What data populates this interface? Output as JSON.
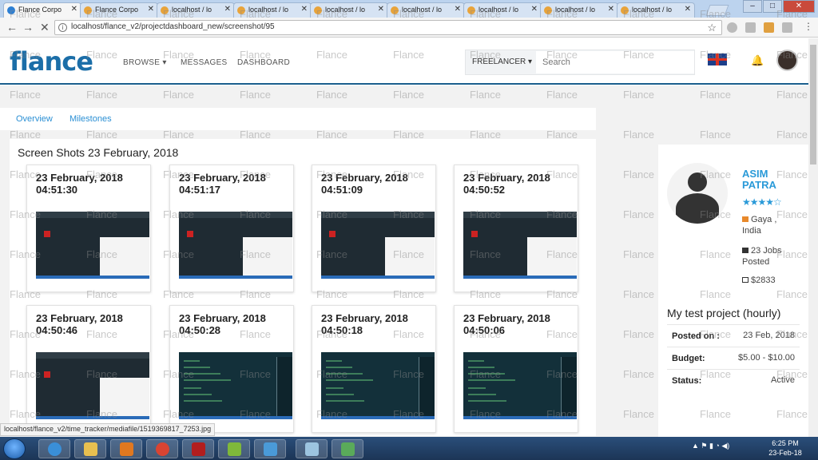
{
  "browser": {
    "tabs": [
      {
        "label": "Flance Corpo",
        "active": true
      },
      {
        "label": "Flance Corpo",
        "active": false
      },
      {
        "label": "localhost / lo",
        "active": false
      },
      {
        "label": "localhost / lo",
        "active": false
      },
      {
        "label": "localhost / lo",
        "active": false
      },
      {
        "label": "localhost / lo",
        "active": false
      },
      {
        "label": "localhost / lo",
        "active": false
      },
      {
        "label": "localhost / lo",
        "active": false
      },
      {
        "label": "localhost / lo",
        "active": false
      }
    ],
    "url": "localhost/flance_v2/projectdashboard_new/screenshot/95",
    "status_url": "localhost/flance_v2/time_tracker/mediafile/1519369817_7253.jpg"
  },
  "header": {
    "logo_text": "flance",
    "nav": {
      "browse": "BROWSE ▾",
      "messages": "MESSAGES",
      "dashboard": "DASHBOARD"
    },
    "search_mode": "FREELANCER ▾",
    "search_placeholder": "Search"
  },
  "subtabs": {
    "overview": "Overview",
    "milestones": "Milestones"
  },
  "screenshots": {
    "title": "Screen Shots 23 February, 2018",
    "items": [
      {
        "date": "23 February, 2018",
        "time": "04:51:30",
        "style": "dark"
      },
      {
        "date": "23 February, 2018",
        "time": "04:51:17",
        "style": "dark"
      },
      {
        "date": "23 February, 2018",
        "time": "04:51:09",
        "style": "dark"
      },
      {
        "date": "23 February, 2018",
        "time": "04:50:52",
        "style": "dark"
      },
      {
        "date": "23 February, 2018",
        "time": "04:50:46",
        "style": "dark"
      },
      {
        "date": "23 February, 2018",
        "time": "04:50:28",
        "style": "code"
      },
      {
        "date": "23 February, 2018",
        "time": "04:50:18",
        "style": "code"
      },
      {
        "date": "23 February, 2018",
        "time": "04:50:06",
        "style": "code"
      }
    ]
  },
  "profile": {
    "name": "ASIM PATRA",
    "rating_stars": "★★★★☆",
    "location": "Gaya , India",
    "jobs": "23 Jobs Posted",
    "spent": "$2833"
  },
  "project": {
    "title": "My test project (hourly)",
    "posted_label": "Posted on :",
    "posted_value": "23 Feb, 2018",
    "budget_label": "Budget:",
    "budget_value": "$5.00 - $10.00",
    "status_label": "Status:",
    "status_value": "Active"
  },
  "watermark_text": "Flance",
  "taskbar": {
    "time": "6:25 PM",
    "date": "23-Feb-18"
  },
  "colors": {
    "brand": "#1b6ea8",
    "link": "#2a8fd4",
    "accent": "#2a9ad8"
  }
}
